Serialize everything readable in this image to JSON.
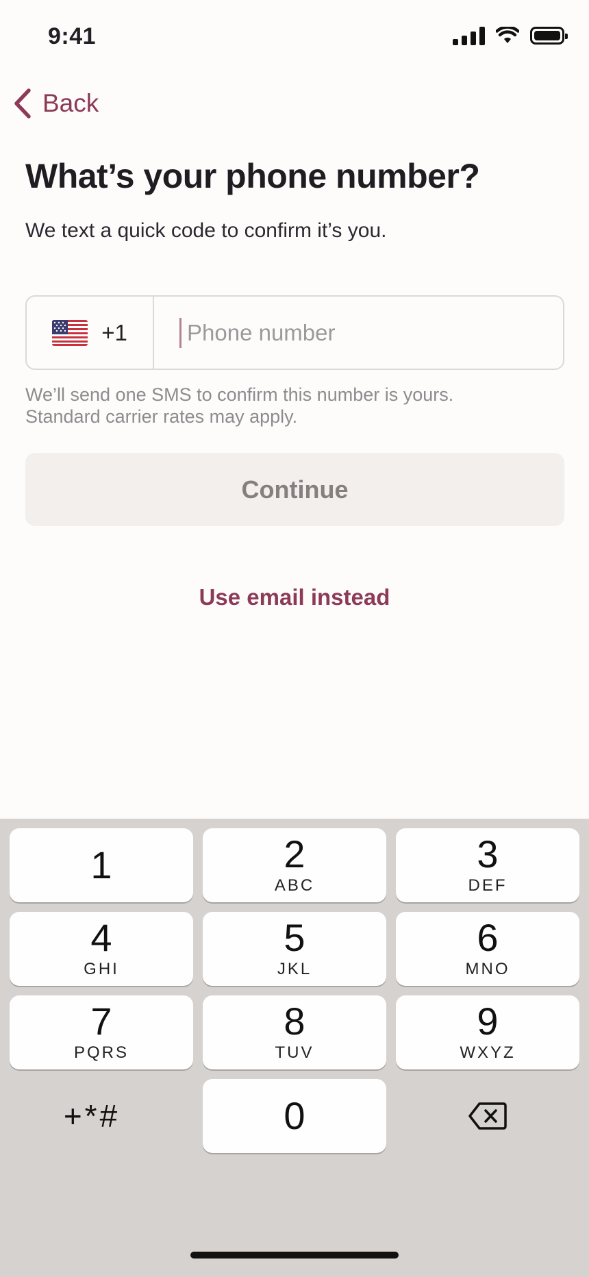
{
  "status_bar": {
    "time": "9:41"
  },
  "nav": {
    "back_label": "Back"
  },
  "header": {
    "title": "What’s your phone number?",
    "subtitle": "We text a quick code to confirm it’s you."
  },
  "phone_field": {
    "country_code": "+1",
    "placeholder": "Phone number",
    "value": ""
  },
  "helper": {
    "line1": "We’ll send one SMS to confirm this number is yours.",
    "line2": "Standard carrier rates may apply."
  },
  "continue_label": "Continue",
  "email_link": "Use email instead",
  "keypad": {
    "keys": [
      {
        "digit": "1",
        "letters": ""
      },
      {
        "digit": "2",
        "letters": "ABC"
      },
      {
        "digit": "3",
        "letters": "DEF"
      },
      {
        "digit": "4",
        "letters": "GHI"
      },
      {
        "digit": "5",
        "letters": "JKL"
      },
      {
        "digit": "6",
        "letters": "MNO"
      },
      {
        "digit": "7",
        "letters": "PQRS"
      },
      {
        "digit": "8",
        "letters": "TUV"
      },
      {
        "digit": "9",
        "letters": "WXYZ"
      },
      {
        "digit": "0",
        "letters": ""
      }
    ],
    "symbols": "+*#"
  },
  "colors": {
    "accent": "#8c3a57",
    "background": "#fdfcfb",
    "keypad_background": "#d6d2cf",
    "button_disabled": "#f2efed"
  }
}
